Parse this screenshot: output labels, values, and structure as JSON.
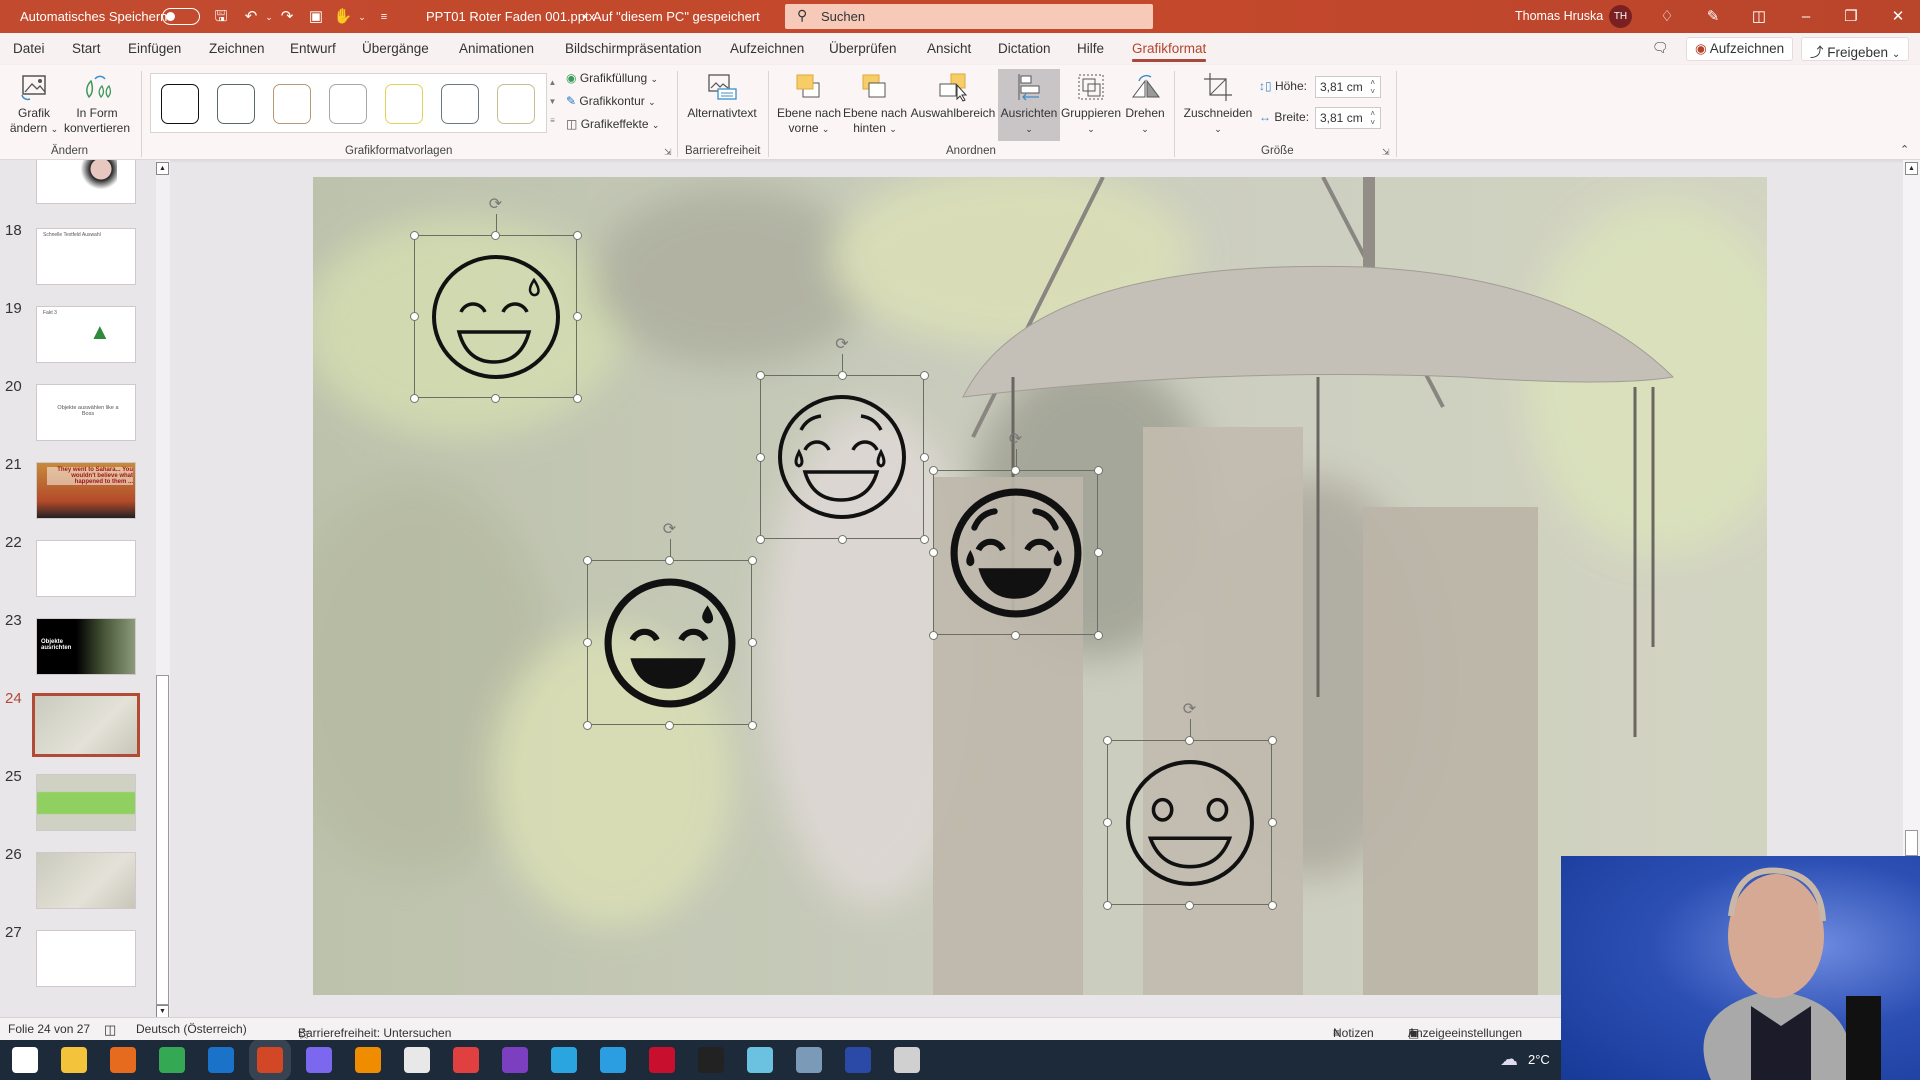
{
  "titlebar": {
    "autosave_label": "Automatisches Speichern",
    "autosave_on": false,
    "document_title": "PPT01 Roter Faden 001.pptx",
    "save_location": "Auf \"diesem PC\" gespeichert",
    "search_placeholder": "Suchen",
    "user_name": "Thomas Hruska",
    "user_initials": "TH"
  },
  "tabs": [
    {
      "label": "Datei"
    },
    {
      "label": "Start"
    },
    {
      "label": "Einfügen"
    },
    {
      "label": "Zeichnen"
    },
    {
      "label": "Entwurf"
    },
    {
      "label": "Übergänge"
    },
    {
      "label": "Animationen"
    },
    {
      "label": "Bildschirmpräsentation"
    },
    {
      "label": "Aufzeichnen"
    },
    {
      "label": "Überprüfen"
    },
    {
      "label": "Ansicht"
    },
    {
      "label": "Dictation"
    },
    {
      "label": "Hilfe"
    },
    {
      "label": "Grafikformat",
      "active": true
    }
  ],
  "header_buttons": {
    "record": "Aufzeichnen",
    "share": "Freigeben"
  },
  "ribbon": {
    "groups": {
      "aendern": "Ändern",
      "vorlagen": "Grafikformatvorlagen",
      "barriere": "Barrierefreiheit",
      "anordnen": "Anordnen",
      "groesse": "Größe"
    },
    "grafik_aendern": [
      "Grafik",
      "ändern"
    ],
    "in_form": [
      "In Form",
      "konvertieren"
    ],
    "fill": "Grafikfüllung",
    "outline": "Grafikkontur",
    "effects": "Grafikeffekte",
    "alt_text": "Alternativtext",
    "bring_forward": [
      "Ebene nach",
      "vorne"
    ],
    "send_backward": [
      "Ebene nach",
      "hinten"
    ],
    "selection_pane": "Auswahlbereich",
    "align": "Ausrichten",
    "group": "Gruppieren",
    "rotate": "Drehen",
    "crop": "Zuschneiden",
    "height_label": "Höhe:",
    "height_value": "3,81 cm",
    "width_label": "Breite:",
    "width_value": "3,81 cm",
    "style_swatch_colors": [
      "#111111",
      "#5a6a6a",
      "#b89a78",
      "#a8a8a8",
      "#e2d45a",
      "#6a7a80",
      "#c8bf90"
    ]
  },
  "slides": [
    {
      "num": "",
      "desc": "Person mit Aufzählung"
    },
    {
      "num": "18",
      "title": "Schnelle Textfeld Auswahl"
    },
    {
      "num": "19",
      "title": "Fakt 3"
    },
    {
      "num": "20",
      "title": "Objekte auswählen like a Boss"
    },
    {
      "num": "21",
      "title": "They went to Sahara... You wouldn't believe what happened to them ..."
    },
    {
      "num": "22",
      "title": ""
    },
    {
      "num": "23",
      "title": "Objekte ausrichten"
    },
    {
      "num": "24",
      "title": "",
      "selected": true
    },
    {
      "num": "25",
      "title": ""
    },
    {
      "num": "26",
      "title": ""
    },
    {
      "num": "27",
      "title": ""
    }
  ],
  "canvas": {
    "emojis": [
      {
        "name": "grinning-sweat-outline"
      },
      {
        "name": "tears-of-joy-outline"
      },
      {
        "name": "tears-of-joy-filled"
      },
      {
        "name": "grinning-sweat-filled"
      },
      {
        "name": "smiling-face-outline"
      }
    ]
  },
  "status": {
    "slide_info": "Folie 24 von 27",
    "language": "Deutsch (Österreich)",
    "accessibility": "Barrierefreiheit: Untersuchen",
    "notes": "Notizen",
    "display_settings": "Anzeigeeinstellungen"
  },
  "taskbar": {
    "apps": [
      {
        "name": "windows-start",
        "color": "#ffffff"
      },
      {
        "name": "file-explorer",
        "color": "#f3c33c"
      },
      {
        "name": "firefox",
        "color": "#e66b1f"
      },
      {
        "name": "chrome",
        "color": "#34a853"
      },
      {
        "name": "outlook",
        "color": "#1a73c9"
      },
      {
        "name": "powerpoint",
        "color": "#d24726",
        "active": true
      },
      {
        "name": "snipping-tool",
        "color": "#7b68ee"
      },
      {
        "name": "vlc",
        "color": "#f08c00"
      },
      {
        "name": "office",
        "color": "#e8e8e8"
      },
      {
        "name": "mouth-app",
        "color": "#e04040"
      },
      {
        "name": "onenote",
        "color": "#7b3fbf"
      },
      {
        "name": "vegas",
        "color": "#2aa5e0"
      },
      {
        "name": "telegram",
        "color": "#2a9ee0"
      },
      {
        "name": "red-app",
        "color": "#c8102e"
      },
      {
        "name": "obs",
        "color": "#222222"
      },
      {
        "name": "magnifier",
        "color": "#6ac1e0"
      },
      {
        "name": "circle-app",
        "color": "#7a9ab8"
      },
      {
        "name": "blue-mic",
        "color": "#2b4aa8"
      },
      {
        "name": "monitor-app",
        "color": "#d0d0d0"
      }
    ],
    "temperature": "2°C"
  }
}
